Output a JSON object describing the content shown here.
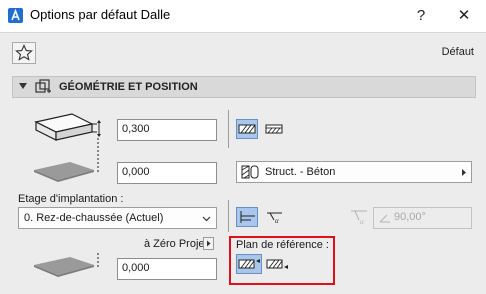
{
  "window": {
    "title": "Options par défaut Dalle",
    "help_label": "?",
    "close_label": "✕"
  },
  "toolbar": {
    "favorites_icon": "star-icon",
    "default_label": "Défaut"
  },
  "section": {
    "title": "GÉOMÉTRIE ET POSITION"
  },
  "geometry": {
    "thickness_value": "0,300",
    "top_offset_value": "0,000",
    "floor_label": "Etage d'implantation :",
    "floor_value": "0. Rez-de-chaussée (Actuel)",
    "project_zero_label": "à Zéro Projet",
    "bottom_offset_value": "0,000"
  },
  "structure": {
    "value": "Struct. - Béton"
  },
  "angle": {
    "value": "90,00°"
  },
  "reference_plane": {
    "label": "Plan de référence :"
  },
  "colors": {
    "selected_button": "#a9c7ec",
    "highlight_border": "#e0101a",
    "panel_bg": "#ececec"
  }
}
